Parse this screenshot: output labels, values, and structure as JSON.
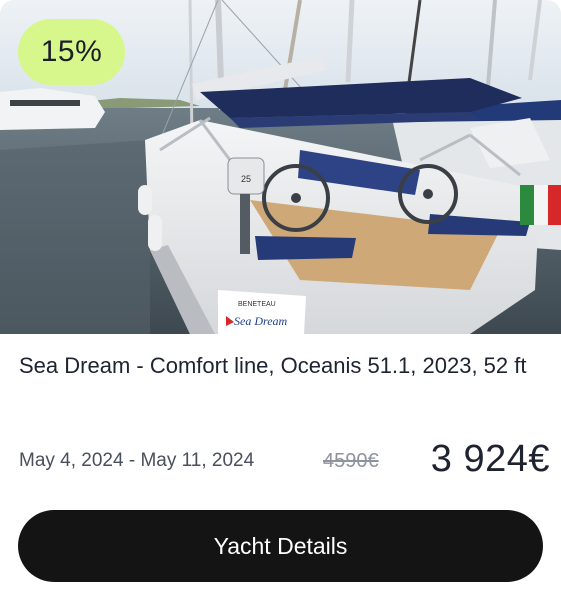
{
  "listing": {
    "discount_badge": "15%",
    "title": "Sea Dream - Comfort line, Oceanis 51.1, 2023, 52 ft",
    "dates": "May 4, 2024 - May 11, 2024",
    "old_price": "4590€",
    "price": "3 924€",
    "details_button": "Yacht Details",
    "photo": {
      "hull_text": "Sea Dream",
      "brand_text": "BENETEAU",
      "engine_text": "25"
    }
  },
  "colors": {
    "badge": "#d7f78c",
    "button": "#141414",
    "text": "#1e2330"
  }
}
